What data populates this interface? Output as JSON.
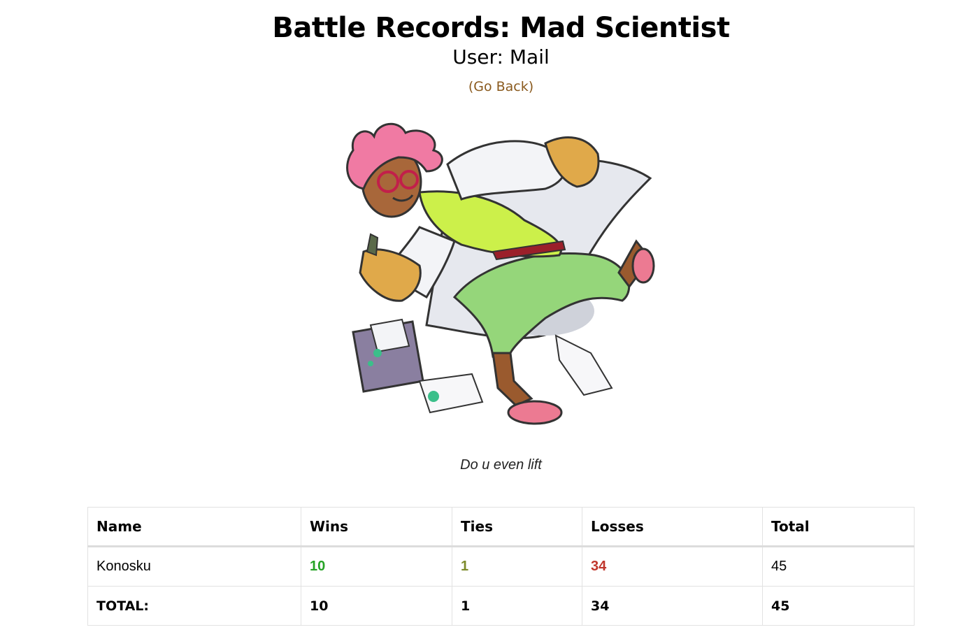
{
  "header": {
    "title": "Battle Records: Mad Scientist",
    "subtitle": "User: Mail",
    "go_back": "(Go Back)"
  },
  "portrait": {
    "icon": "mad-scientist-illustration",
    "caption": "Do u even lift"
  },
  "colors": {
    "wins": "#25a325",
    "ties": "#7c8a2a",
    "losses": "#c0362c",
    "link": "#8a5a1e"
  },
  "table": {
    "headers": [
      "Name",
      "Wins",
      "Ties",
      "Losses",
      "Total"
    ],
    "rows": [
      {
        "name": "Konosku",
        "wins": "10",
        "ties": "1",
        "losses": "34",
        "total": "45"
      }
    ],
    "totals": {
      "label": "TOTAL:",
      "wins": "10",
      "ties": "1",
      "losses": "34",
      "total": "45"
    }
  }
}
